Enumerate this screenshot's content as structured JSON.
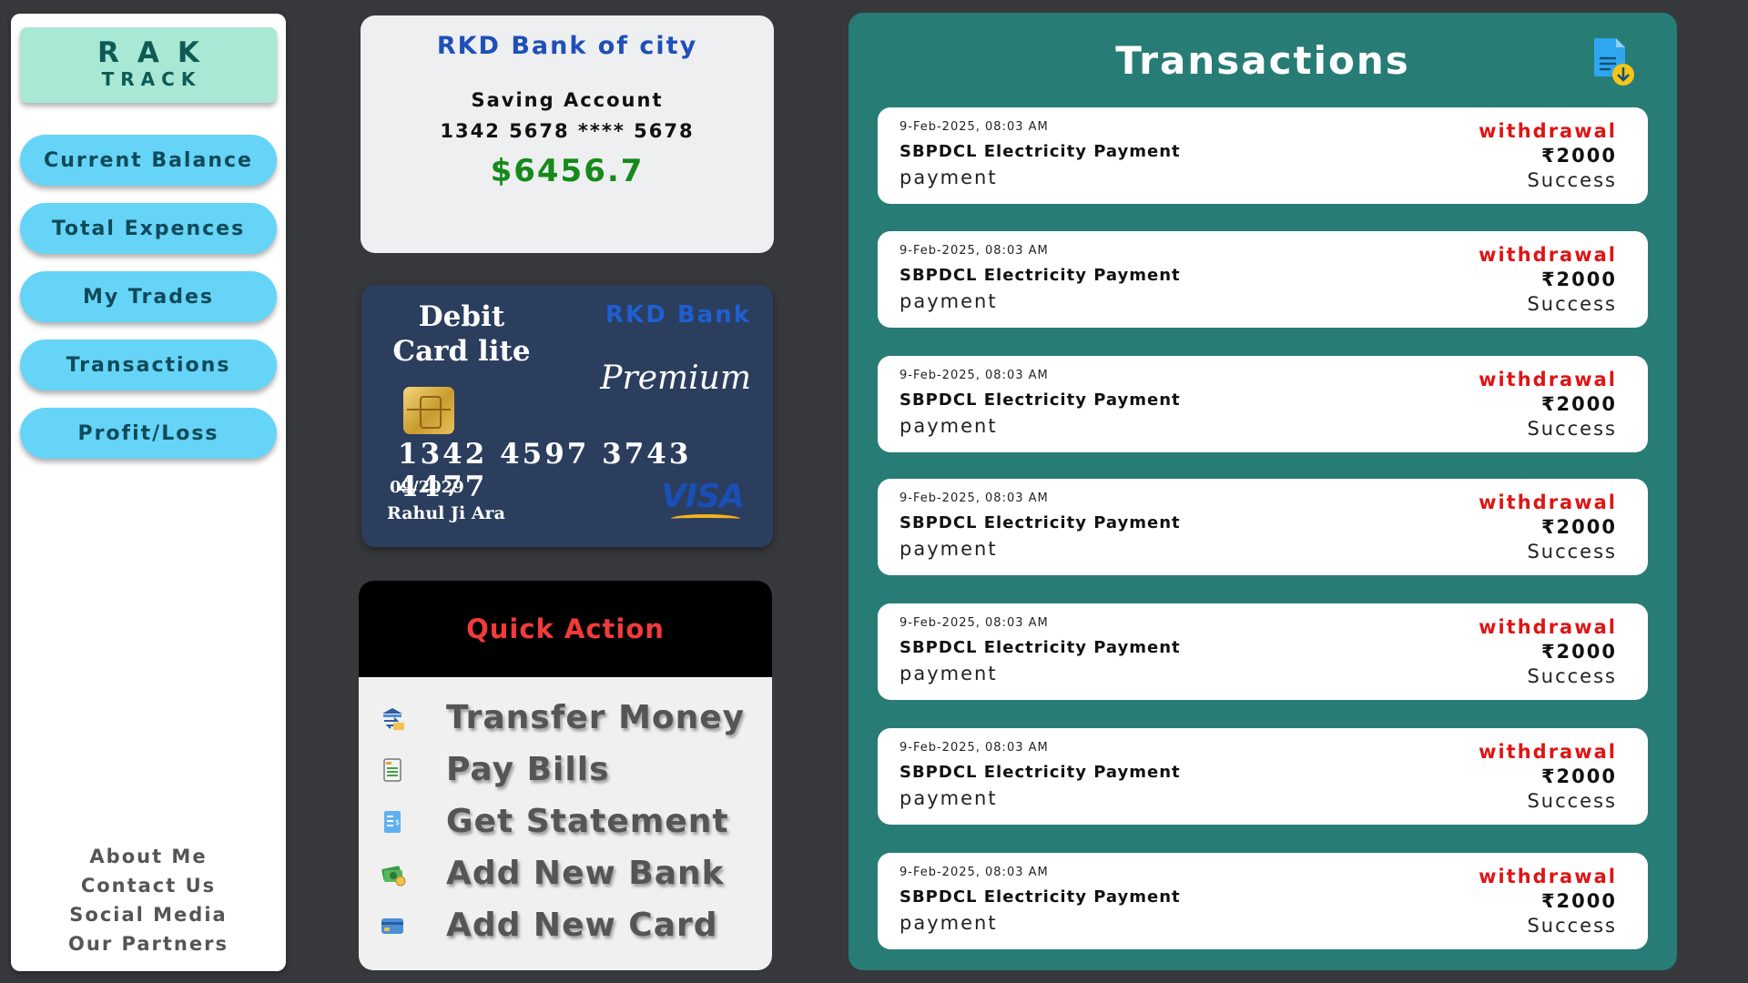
{
  "sidebar": {
    "logo_line1": "RAK",
    "logo_line2": "TRACK",
    "nav": [
      "Current Balance",
      "Total Expences",
      "My Trades",
      "Transactions",
      "Profit/Loss"
    ],
    "footer": [
      "About Me",
      "Contact Us",
      "Social Media",
      "Our Partners"
    ]
  },
  "bank": {
    "name": "RKD Bank of city",
    "account_type": "Saving Account",
    "account_number": "1342 5678 **** 5678",
    "balance": "$6456.7"
  },
  "debit_card": {
    "title": "Debit Card lite",
    "bank": "RKD Bank",
    "tier": "Premium",
    "number": "1342 4597 3743 4477",
    "expiry": "09/2029",
    "holder": "Rahul Ji Ara",
    "network": "VISA"
  },
  "quick_action": {
    "title": "Quick Action",
    "items": [
      {
        "label": "Transfer Money",
        "icon": "transfer-money-icon"
      },
      {
        "label": "Pay Bills",
        "icon": "bill-icon"
      },
      {
        "label": "Get Statement",
        "icon": "statement-icon"
      },
      {
        "label": "Add New Bank",
        "icon": "bank-money-icon"
      },
      {
        "label": "Add New Card",
        "icon": "credit-card-icon"
      }
    ]
  },
  "transactions": {
    "title": "Transactions",
    "download_icon": "download-document-icon",
    "items": [
      {
        "time": "9-Feb-2025, 08:03 AM",
        "name": "SBPDCL Electricity Payment",
        "category": "payment",
        "type": "withdrawal",
        "amount": "₹2000",
        "status": "Success"
      },
      {
        "time": "9-Feb-2025, 08:03 AM",
        "name": "SBPDCL Electricity Payment",
        "category": "payment",
        "type": "withdrawal",
        "amount": "₹2000",
        "status": "Success"
      },
      {
        "time": "9-Feb-2025, 08:03 AM",
        "name": "SBPDCL Electricity Payment",
        "category": "payment",
        "type": "withdrawal",
        "amount": "₹2000",
        "status": "Success"
      },
      {
        "time": "9-Feb-2025, 08:03 AM",
        "name": "SBPDCL Electricity Payment",
        "category": "payment",
        "type": "withdrawal",
        "amount": "₹2000",
        "status": "Success"
      },
      {
        "time": "9-Feb-2025, 08:03 AM",
        "name": "SBPDCL Electricity Payment",
        "category": "payment",
        "type": "withdrawal",
        "amount": "₹2000",
        "status": "Success"
      },
      {
        "time": "9-Feb-2025, 08:03 AM",
        "name": "SBPDCL Electricity Payment",
        "category": "payment",
        "type": "withdrawal",
        "amount": "₹2000",
        "status": "Success"
      },
      {
        "time": "9-Feb-2025, 08:03 AM",
        "name": "SBPDCL Electricity Payment",
        "category": "payment",
        "type": "withdrawal",
        "amount": "₹2000",
        "status": "Success"
      }
    ]
  },
  "colors": {
    "background": "#37383c",
    "logo_bg": "#a8e8d4",
    "nav_button": "#66d4f6",
    "balance_green": "#158a1a",
    "bank_blue": "#1f4fb8",
    "card_bg": "#2b3e5e",
    "panel_teal": "#277c76",
    "withdrawal_red": "#e01414",
    "quick_action_red": "#f23a3a"
  }
}
